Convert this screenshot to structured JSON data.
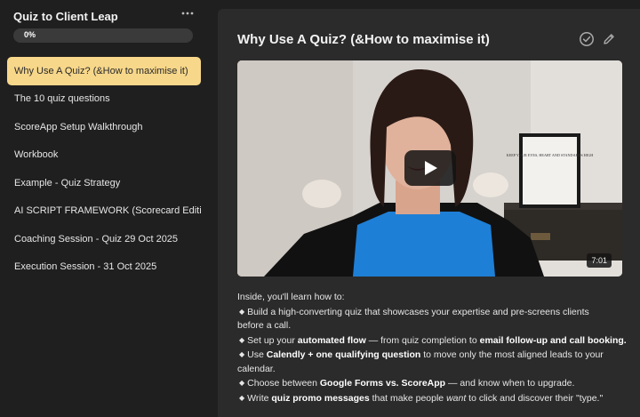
{
  "sidebar": {
    "course_title": "Quiz to Client Leap",
    "more_icon": "ellipsis-icon",
    "progress": {
      "label": "0%",
      "value": 0
    },
    "items": [
      {
        "label": "Why Use A Quiz? (&How to maximise it)",
        "active": true
      },
      {
        "label": "The 10 quiz questions"
      },
      {
        "label": "ScoreApp Setup Walkthrough"
      },
      {
        "label": "Workbook"
      },
      {
        "label": "Example - Quiz Strategy"
      },
      {
        "label": "AI SCRIPT FRAMEWORK (Scorecard Edition)"
      },
      {
        "label": "Coaching Session - Quiz 29 Oct 2025"
      },
      {
        "label": "Execution Session - 31 Oct 2025"
      }
    ]
  },
  "main": {
    "title": "Why Use A Quiz? (&How to maximise it)",
    "complete_icon": "check-circle-icon",
    "edit_icon": "pencil-icon",
    "video": {
      "duration": "7:01",
      "play_icon": "play-icon",
      "poster_print": "KEEP YOUR EYES, HEART AND STANDARDS HIGH"
    },
    "description": {
      "intro": "Inside, you'll learn how to:",
      "b1_a": "Build a high-converting quiz that showcases your expertise and pre-screens clients",
      "b1_b": "before a call.",
      "b2_a": "Set up your ",
      "b2_bold1": "automated flow",
      "b2_mid": " — from quiz completion to ",
      "b2_bold2": "email follow-up and call booking.",
      "b3_a": "Use ",
      "b3_bold1": "Calendly + one qualifying question",
      "b3_mid": " to move only the most aligned leads to your",
      "b3_b": "calendar.",
      "b4_a": "Choose between ",
      "b4_bold1": "Google Forms vs. ScoreApp",
      "b4_mid": " — and know when to upgrade.",
      "b5_a": "Write ",
      "b5_bold1": "quiz promo messages",
      "b5_mid": " that make people ",
      "b5_ital": "want",
      "b5_end": " to click and discover their \"type.\""
    }
  }
}
